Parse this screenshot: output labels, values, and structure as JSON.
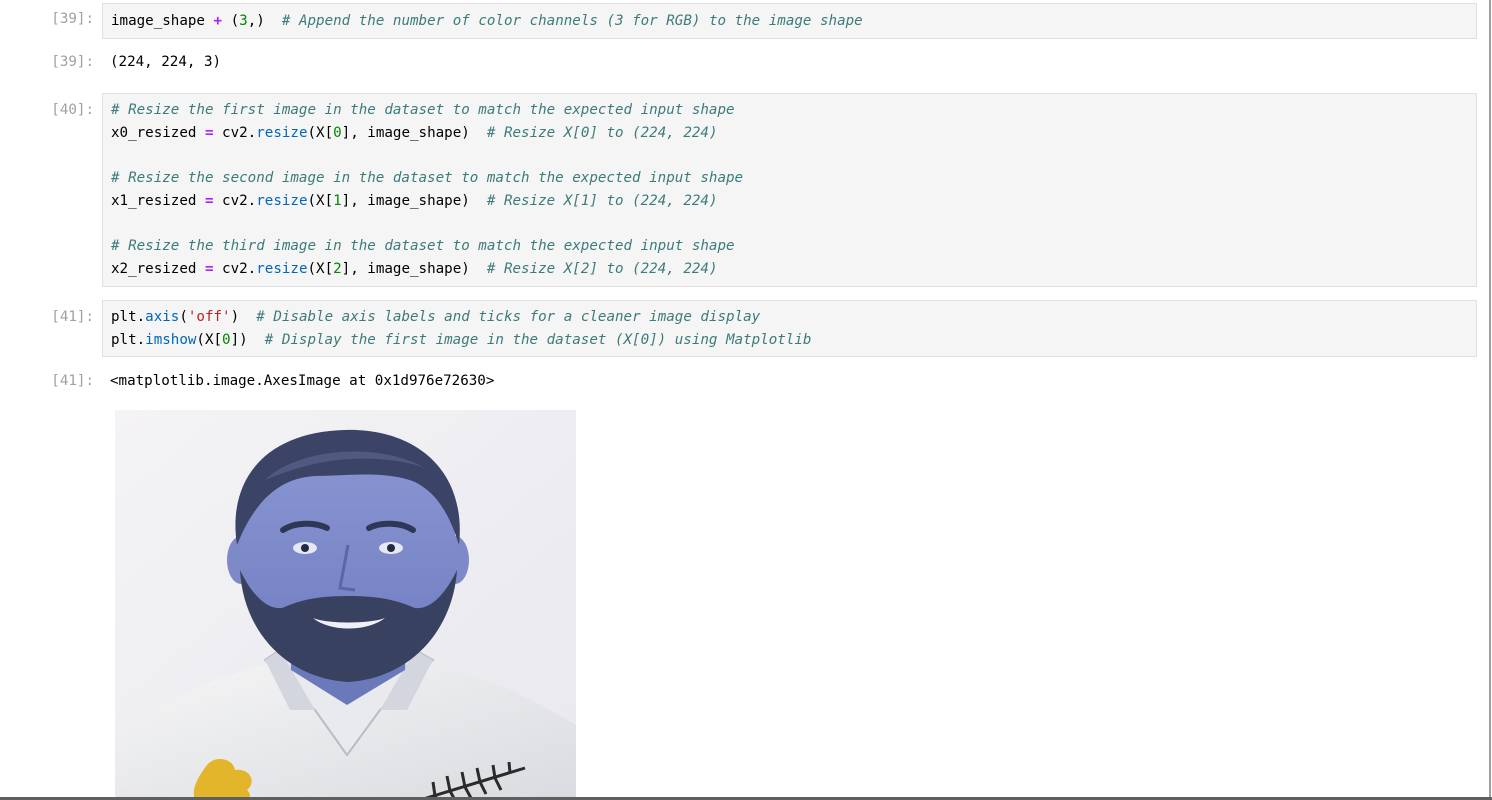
{
  "cells": [
    {
      "in_prompt": "[39]:",
      "code": {
        "l1_a": "image_shape ",
        "l1_op": "+",
        "l1_b": " (",
        "l1_num": "3",
        "l1_c": ",)  ",
        "l1_comment": "# Append the number of color channels (3 for RGB) to the image shape"
      },
      "out_prompt": "[39]:",
      "output": "(224, 224, 3)"
    },
    {
      "in_prompt": "[40]:",
      "code": {
        "c1": "# Resize the first image in the dataset to match the expected input shape",
        "c2": "# Resize the second image in the dataset to match the expected input shape",
        "c3": "# Resize the third image in the dataset to match the expected input shape",
        "v1": "x0_resized ",
        "v2": "x1_resized ",
        "v3": "x2_resized ",
        "eq": "=",
        "obj": " cv2.",
        "method": "resize",
        "arg_open": "(X[",
        "i0": "0",
        "i1": "1",
        "i2": "2",
        "arg_close": "], image_shape)  ",
        "t1": "# Resize X[0] to (224, 224)",
        "t2": "# Resize X[1] to (224, 224)",
        "t3": "# Resize X[2] to (224, 224)"
      }
    },
    {
      "in_prompt": "[41]:",
      "code": {
        "plt": "plt.",
        "axis": "axis",
        "paren_open": "(",
        "off": "'off'",
        "paren_close": ")  ",
        "axis_comment": "# Disable axis labels and ticks for a cleaner image display",
        "imshow": "imshow",
        "imshow_open": "(X[",
        "idx": "0",
        "imshow_close": "])  ",
        "imshow_comment": "# Display the first image in the dataset (X[0]) using Matplotlib"
      },
      "out_prompt": "[41]:",
      "output": "<matplotlib.image.AxesImage at 0x1d976e72630>"
    }
  ],
  "plot_image": "portrait-photo",
  "colors": {
    "prompt": "#a0a0a0",
    "comment": "#3d7b7b",
    "operator": "#aa22ff",
    "method": "#0066bb",
    "number": "#008800",
    "string": "#ba2121",
    "cell_bg": "#f5f5f5"
  }
}
